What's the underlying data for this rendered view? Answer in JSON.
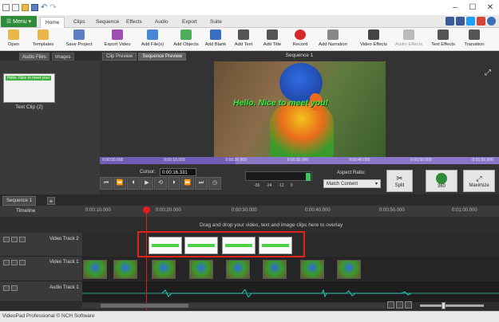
{
  "quick_access": {
    "icons": [
      "app-icon",
      "new-icon",
      "open-folder-icon",
      "save-icon",
      "undo-icon",
      "redo-icon"
    ]
  },
  "window_controls": {
    "minimize": "–",
    "maximize": "☐",
    "close": "✕"
  },
  "menu_button": {
    "label": "Menu"
  },
  "tabs": [
    "Home",
    "Clips",
    "Sequence",
    "Effects",
    "Audio",
    "Export",
    "Suite"
  ],
  "active_tab": "Home",
  "toolbar": {
    "items": [
      {
        "label": "Open",
        "icon": "open-icon",
        "color": "#e8b949"
      },
      {
        "label": "Templates",
        "icon": "templates-icon",
        "color": "#e8b949"
      },
      {
        "label": "Save Project",
        "icon": "save-project-icon",
        "color": "#5b7fc2"
      },
      {
        "label": "Export Video",
        "icon": "export-video-icon",
        "color": "#9b4fb5"
      },
      {
        "label": "Add File(s)",
        "icon": "add-files-icon",
        "color": "#4a86d8"
      },
      {
        "label": "Add Objects",
        "icon": "add-objects-icon",
        "color": "#4fae5a"
      },
      {
        "label": "Add Blank",
        "icon": "add-blank-icon",
        "color": "#3a6ec4"
      },
      {
        "label": "Add Text",
        "icon": "add-text-icon",
        "color": "#555555"
      },
      {
        "label": "Add Title",
        "icon": "add-title-icon",
        "color": "#555555"
      },
      {
        "label": "Record",
        "icon": "record-icon",
        "color": "#d8292a"
      },
      {
        "label": "Add Narration",
        "icon": "add-narration-icon",
        "color": "#888888"
      },
      {
        "label": "Video Effects",
        "icon": "video-effects-icon",
        "color": "#444444"
      },
      {
        "label": "Audio Effects",
        "icon": "audio-effects-icon",
        "color": "#bbbbbb"
      },
      {
        "label": "Text Effects",
        "icon": "text-effects-icon",
        "color": "#555555"
      },
      {
        "label": "Transition",
        "icon": "transition-icon",
        "color": "#555555"
      }
    ]
  },
  "left_panel": {
    "tabs": [
      "Audio Files",
      "Images"
    ],
    "clip": {
      "label": "Text Clip (2)",
      "thumb_text": "Hello. Nice to meet you!"
    }
  },
  "preview": {
    "tabs": [
      "Clip Preview",
      "Sequence Preview"
    ],
    "active": "Sequence Preview",
    "sequence_title": "Sequence 1",
    "overlay_text": "Hello. Nice to meet you!",
    "cursor_label": "Cursor:",
    "cursor_value": "0:00:16.331",
    "scrubber_ticks": [
      "0:00:00.000",
      "0:00:10.000",
      "0:00:20.000",
      "0:00:30.000",
      "0:00:40.000",
      "0:00:50.000",
      "0:01:00.000"
    ],
    "transport": [
      "⏮",
      "⏪",
      "⏴",
      "▶",
      "⟲",
      "⏵",
      "⏩",
      "⏭",
      "◷"
    ],
    "vu_labels": [
      "-36",
      "-24",
      "-12",
      "0"
    ],
    "aspect_label": "Aspect Ratio:",
    "aspect_value": "Match Content",
    "split_label": "Split",
    "btn_360": "360",
    "maximize_label": "Maximize"
  },
  "timeline": {
    "sequence_tab": "Sequence 1",
    "add_tab": "+",
    "title": "Timeline",
    "ruler_ticks": [
      "0:00:10.000",
      "0:00:20.000",
      "0:00:30.000",
      "0:00:40.000",
      "0:00:50.000",
      "0:01:00.000"
    ],
    "drop_message": "Drag and drop your video, text and image clips here to overlay",
    "tracks": [
      {
        "name": "Video Track 2"
      },
      {
        "name": "Video Track 1"
      },
      {
        "name": "Audio Track 1"
      }
    ],
    "highlight_color": "#e2231a"
  },
  "status": {
    "text": "VideoPad Professional © NCH Software"
  }
}
